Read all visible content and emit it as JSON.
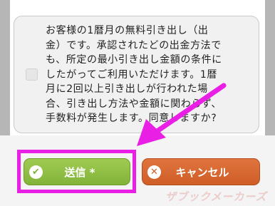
{
  "notice": {
    "text": "お客様の1暦月の無料引き出し（出\n金）です。承認されたどの出金方法で\nも、所定の最小引き出し金額の条件に\nしたがってご利用いただけます。1暦\n月に2回以上引き出しが行われた場\n合、引き出し方法や金額に関わらず、\n手数料が発生します。同意しますか?"
  },
  "buttons": {
    "submit_label": "送信 *",
    "submit_icon": "check-icon",
    "cancel_label": "キャンセル",
    "cancel_icon": "close-icon"
  },
  "annotation": {
    "highlight_color": "#ea1fe6",
    "arrow_color": "#ea1fe6"
  },
  "watermark": {
    "text": "ザブックメーカーズ"
  },
  "colors": {
    "submit": "#8fc045",
    "cancel": "#d9662f",
    "background": "#f4f4f4"
  }
}
